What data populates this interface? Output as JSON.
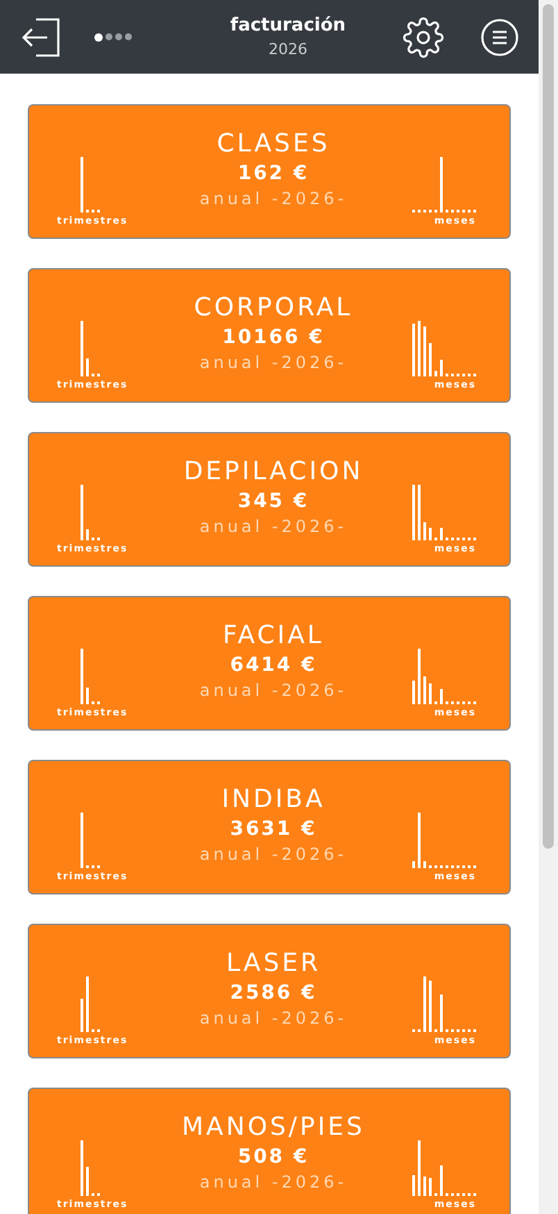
{
  "header": {
    "title": "facturación",
    "year": "2026",
    "pages": [
      {
        "selected": true
      },
      {
        "selected": false
      },
      {
        "selected": false
      },
      {
        "selected": false
      }
    ]
  },
  "cards": [
    {
      "name": "CLASES",
      "amount": "162 €",
      "period": "anual -2026-",
      "left_label": "trimestres",
      "right_label": "meses"
    },
    {
      "name": "CORPORAL",
      "amount": "10166 €",
      "period": "anual -2026-",
      "left_label": "trimestres",
      "right_label": "meses"
    },
    {
      "name": "DEPILACION",
      "amount": "345 €",
      "period": "anual -2026-",
      "left_label": "trimestres",
      "right_label": "meses"
    },
    {
      "name": "FACIAL",
      "amount": "6414 €",
      "period": "anual -2026-",
      "left_label": "trimestres",
      "right_label": "meses"
    },
    {
      "name": "INDIBA",
      "amount": "3631 €",
      "period": "anual -2026-",
      "left_label": "trimestres",
      "right_label": "meses"
    },
    {
      "name": "LASER",
      "amount": "2586 €",
      "period": "anual -2026-",
      "left_label": "trimestres",
      "right_label": "meses"
    },
    {
      "name": "MANOS/PIES",
      "amount": "508 €",
      "period": "anual -2026-",
      "left_label": "trimestres",
      "right_label": "meses"
    }
  ]
}
